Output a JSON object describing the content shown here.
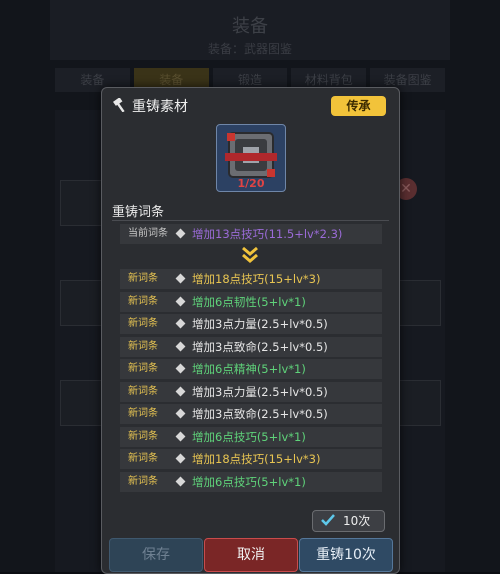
{
  "background": {
    "title": "装备",
    "subtitle": "装备：武器图鉴",
    "tabs": [
      "装备",
      "装备",
      "锻造",
      "材料背包",
      "装备图鉴"
    ]
  },
  "modal": {
    "title": "重铸素材",
    "inherit_label": "传承",
    "material": {
      "count_text": "1/20",
      "icon": "anvil-material-icon"
    },
    "section_title": "重铸词条",
    "current": {
      "tag": "当前词条",
      "text": "增加13点技巧(11.5+lv*2.3)",
      "color": "#9b6bd8"
    },
    "new_entries": [
      {
        "tag": "新词条",
        "text": "增加18点技巧(15+lv*3)",
        "color": "#e8c552"
      },
      {
        "tag": "新词条",
        "text": "增加6点韧性(5+lv*1)",
        "color": "#5fd37a"
      },
      {
        "tag": "新词条",
        "text": "增加3点力量(2.5+lv*0.5)",
        "color": "#e6e6e6"
      },
      {
        "tag": "新词条",
        "text": "增加3点致命(2.5+lv*0.5)",
        "color": "#e6e6e6"
      },
      {
        "tag": "新词条",
        "text": "增加6点精神(5+lv*1)",
        "color": "#5fd37a"
      },
      {
        "tag": "新词条",
        "text": "增加3点力量(2.5+lv*0.5)",
        "color": "#e6e6e6"
      },
      {
        "tag": "新词条",
        "text": "增加3点致命(2.5+lv*0.5)",
        "color": "#e6e6e6"
      },
      {
        "tag": "新词条",
        "text": "增加6点技巧(5+lv*1)",
        "color": "#5fd37a"
      },
      {
        "tag": "新词条",
        "text": "增加18点技巧(15+lv*3)",
        "color": "#e8c552"
      },
      {
        "tag": "新词条",
        "text": "增加6点技巧(5+lv*1)",
        "color": "#5fd37a"
      }
    ],
    "repeat_count_label": "10次",
    "buttons": {
      "save": "保存",
      "cancel": "取消",
      "recast": "重铸10次"
    }
  }
}
